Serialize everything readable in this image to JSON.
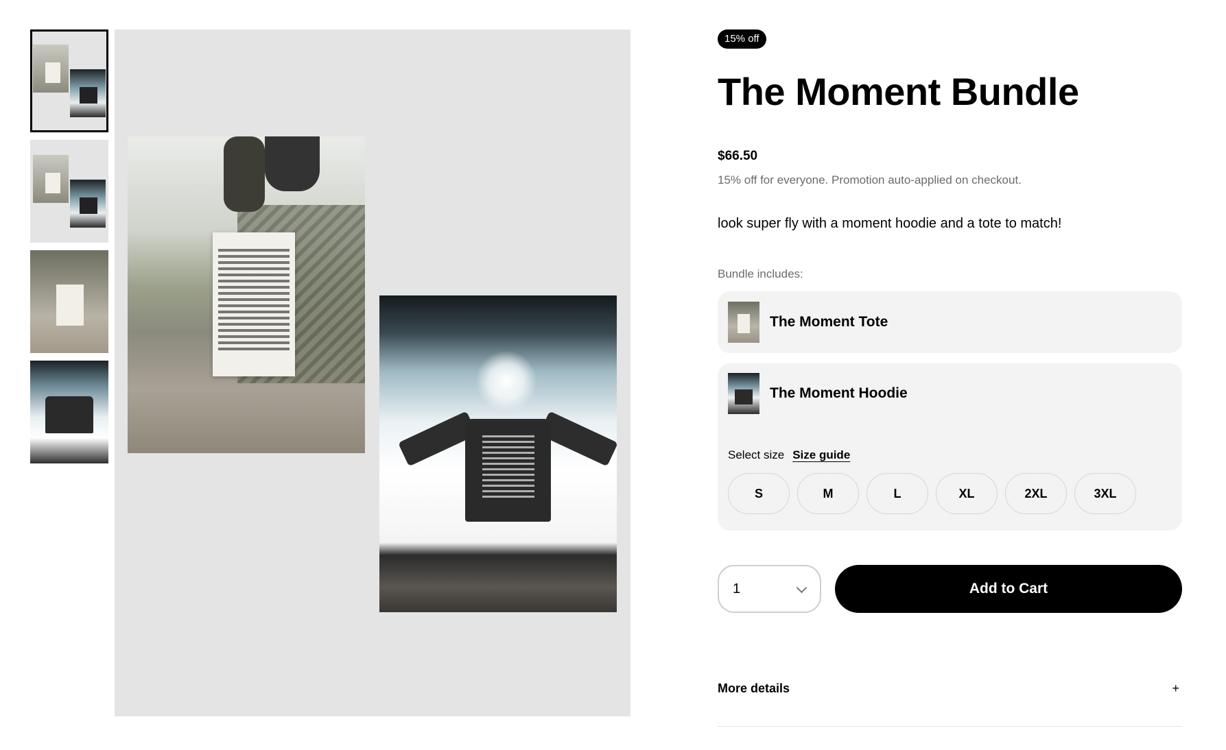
{
  "product": {
    "badge": "15% off",
    "title": "The Moment Bundle",
    "price": "$66.50",
    "promo": "15% off for everyone. Promotion auto-applied on checkout.",
    "description": "look super fly with a moment hoodie and a tote to match!"
  },
  "gallery": {
    "thumbnails": [
      "bundle-collage",
      "bundle-collage",
      "tote-photo",
      "hoodie-photo"
    ],
    "active_index": 0
  },
  "bundle": {
    "label": "Bundle includes:",
    "items": [
      {
        "name": "The Moment Tote"
      },
      {
        "name": "The Moment Hoodie"
      }
    ]
  },
  "size": {
    "select_label": "Select size",
    "guide_label": "Size guide",
    "options": [
      "S",
      "M",
      "L",
      "XL",
      "2XL",
      "3XL"
    ]
  },
  "cart": {
    "quantity": "1",
    "add_label": "Add to Cart"
  },
  "details": {
    "label": "More details",
    "toggle": "+"
  },
  "icons": {
    "quantity_dropdown": "chevron-down-icon"
  },
  "colors": {
    "accent": "#000000",
    "card_bg": "#f3f3f3",
    "gallery_bg": "#e4e4e4",
    "muted_text": "#6b6b6b"
  }
}
